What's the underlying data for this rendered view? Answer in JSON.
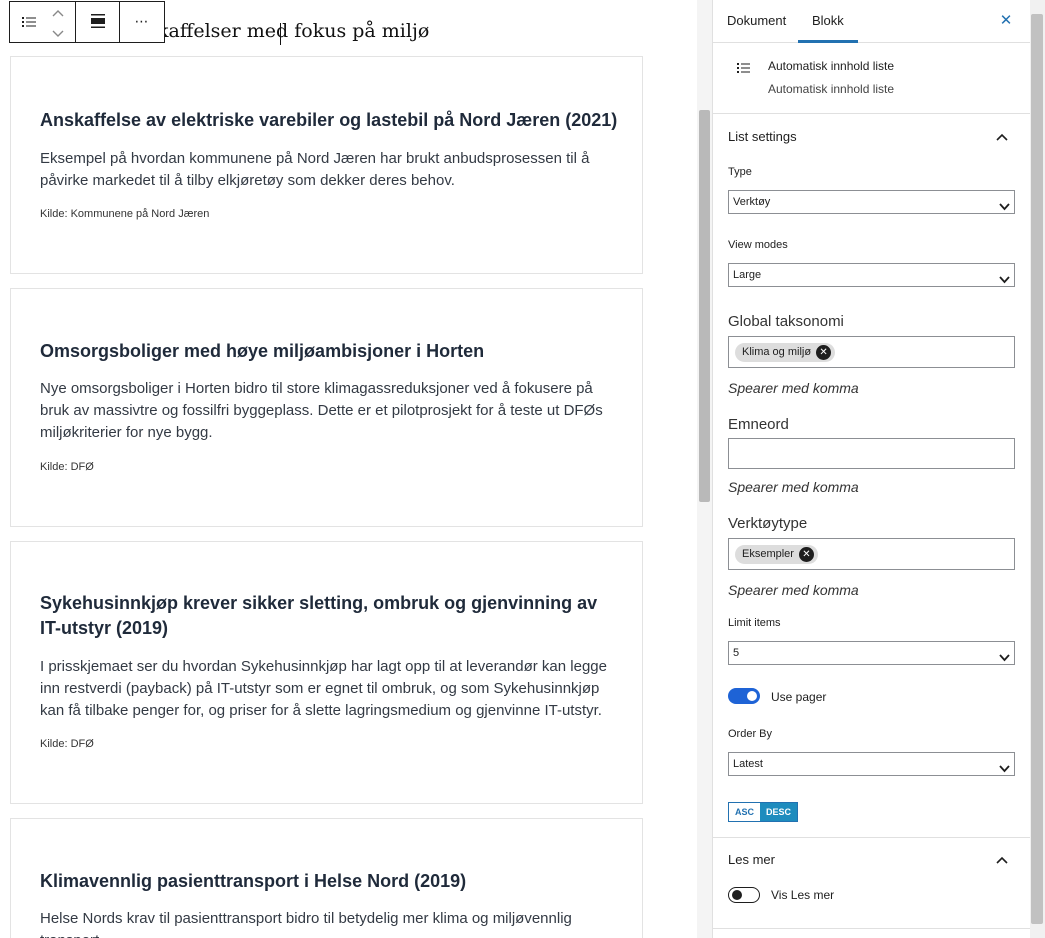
{
  "editor": {
    "heading": "kaffelser med fokus på miljø",
    "toolbar": {
      "list_icon": "list-view-icon",
      "move_up_icon": "chevron-up-icon",
      "move_down_icon": "chevron-down-icon",
      "align_icon": "align-wide-icon",
      "more_icon": "more-options-icon",
      "more_label": "⋯"
    },
    "cards": [
      {
        "title": "Anskaffelse av elektriske varebiler og lastebil på Nord Jæren (2021)",
        "text": "Eksempel på hvordan kommunene på Nord Jæren har brukt anbudsprosessen til å påvirke markedet til å tilby elkjøretøy som dekker deres behov.",
        "source": "Kilde: Kommunene på Nord Jæren"
      },
      {
        "title": "Omsorgsboliger med høye miljøambisjoner i Horten",
        "text": "Nye omsorgsboliger i Horten bidro til store klimagassreduksjoner ved å fokusere på bruk av massivtre og fossilfri byggeplass. Dette er et pilotprosjekt for å teste ut DFØs miljøkriterier for nye bygg.",
        "source": "Kilde: DFØ"
      },
      {
        "title": "Sykehusinnkjøp krever sikker sletting, ombruk og gjenvinning av IT-utstyr (2019)",
        "text": "I prisskjemaet ser du hvordan Sykehusinnkjøp har lagt opp til at leverandør kan legge inn restverdi (payback) på IT-utstyr som er egnet til ombruk, og som Sykehusinnkjøp kan få tilbake penger for, og priser for å slette lagringsmedium og gjenvinne IT-utstyr.",
        "source": "Kilde: DFØ"
      },
      {
        "title": "Klimavennlig pasienttransport i Helse Nord (2019)",
        "text": "Helse Nords krav til pasienttransport bidro til betydelig mer klima og miljøvennlig transport."
      }
    ]
  },
  "sidebar": {
    "tabs": [
      "Dokument",
      "Blokk"
    ],
    "close_label": "✕",
    "block": {
      "title": "Automatisk innhold liste",
      "description": "Automatisk innhold liste",
      "icon": "list-icon"
    },
    "list_settings": {
      "title": "List settings",
      "type_label": "Type",
      "type_value": "Verktøy",
      "view_modes_label": "View modes",
      "view_modes_value": "Large",
      "global_tax_label": "Global taksonomi",
      "global_tax_token": "Klima og miljø",
      "global_tax_help": "Spearer med komma",
      "emneord_label": "Emneord",
      "emneord_help": "Spearer med komma",
      "verktoy_label": "Verktøytype",
      "verktoy_token": "Eksempler",
      "verktoy_help": "Spearer med komma",
      "limit_label": "Limit items",
      "limit_value": "5",
      "use_pager_label": "Use pager",
      "use_pager_on": true,
      "order_by_label": "Order By",
      "order_by_value": "Latest",
      "asc_label": "ASC",
      "desc_label": "DESC",
      "sort_selected": "DESC"
    },
    "les_mer": {
      "title": "Les mer",
      "toggle_label": "Vis Les mer",
      "toggle_on": false
    }
  },
  "colors": {
    "accent": "#2271b1",
    "toggle_on": "#1e63d6",
    "desc_active": "#1e8cbe"
  }
}
